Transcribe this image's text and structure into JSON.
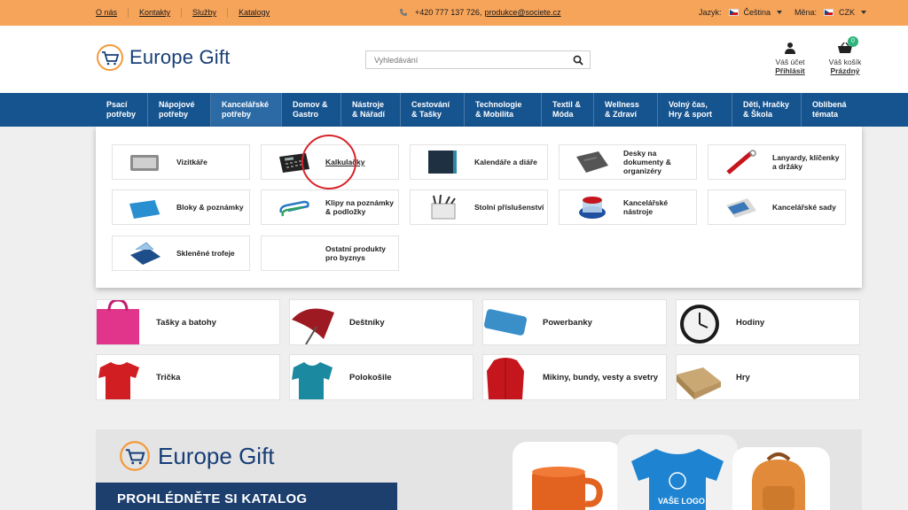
{
  "topbar": {
    "links": [
      "O nás",
      "Kontakty",
      "Služby",
      "Katalogy"
    ],
    "phone": "+420 777 137 726,",
    "email": "produkce@societe.cz",
    "language_label": "Jazyk:",
    "language_value": "Čeština",
    "currency_label": "Měna:",
    "currency_value": "CZK"
  },
  "header": {
    "logo_text": "Europe Gift",
    "search_placeholder": "Vyhledávání",
    "account_line1": "Váš účet",
    "account_line2": "Přihlásit",
    "cart_line1": "Váš košík",
    "cart_line2": "Prázdný",
    "cart_count": "0"
  },
  "nav": {
    "items": [
      {
        "l1": "Psací",
        "l2": "potřeby"
      },
      {
        "l1": "Nápojové",
        "l2": "potřeby"
      },
      {
        "l1": "Kancelářské",
        "l2": "potřeby"
      },
      {
        "l1": "Domov &",
        "l2": "Gastro"
      },
      {
        "l1": "Nástroje",
        "l2": "& Nářadí"
      },
      {
        "l1": "Cestování",
        "l2": "& Tašky"
      },
      {
        "l1": "Technologie",
        "l2": "& Mobilita"
      },
      {
        "l1": "Textil &",
        "l2": "Móda"
      },
      {
        "l1": "Wellness",
        "l2": "& Zdraví"
      },
      {
        "l1": "Volný čas,",
        "l2": "Hry & sport"
      },
      {
        "l1": "Děti, Hračky",
        "l2": "& Škola"
      },
      {
        "l1": "Oblíbená",
        "l2": "témata"
      }
    ]
  },
  "mega": {
    "items": [
      {
        "label": "Vizitkáře",
        "icon": "business-card-holder-icon"
      },
      {
        "label": "Kalkulačky",
        "icon": "calculator-icon"
      },
      {
        "label": "Kalendáře a diáře",
        "icon": "diary-icon"
      },
      {
        "label": "Desky na dokumenty & organizéry",
        "icon": "organizer-icon"
      },
      {
        "label": "Lanyardy, klíčenky a držáky",
        "icon": "lanyard-icon"
      },
      {
        "label": "Bloky & poznámky",
        "icon": "notepad-icon"
      },
      {
        "label": "Klipy na poznámky & podložky",
        "icon": "paper-clip-icon"
      },
      {
        "label": "Stolní příslušenství",
        "icon": "desk-organizer-icon"
      },
      {
        "label": "Kancelářské nástroje",
        "icon": "dispenser-icon"
      },
      {
        "label": "Kancelářské sady",
        "icon": "office-set-icon"
      },
      {
        "label": "Skleněné trofeje",
        "icon": "glass-trophy-icon"
      },
      {
        "label": "Ostatní produkty pro byznys",
        "icon": ""
      }
    ]
  },
  "categories": [
    {
      "label": "Tašky a batohy",
      "icon": "bag-icon"
    },
    {
      "label": "Deštníky",
      "icon": "umbrella-icon"
    },
    {
      "label": "Powerbanky",
      "icon": "powerbank-icon"
    },
    {
      "label": "Hodiny",
      "icon": "clock-icon"
    },
    {
      "label": "Trička",
      "icon": "tshirt-icon"
    },
    {
      "label": "Polokošile",
      "icon": "polo-icon"
    },
    {
      "label": "Mikiny, bundy, vesty a svetry",
      "icon": "jacket-icon"
    },
    {
      "label": "Hry",
      "icon": "board-game-icon"
    }
  ],
  "banner": {
    "logo_text": "Europe Gift",
    "cta": "PROHLÉDNĚTE SI KATALOG",
    "shirt_text": "VAŠE LOGO"
  },
  "colors": {
    "topbar": "#f6a45a",
    "nav": "#16548f",
    "brand_blue": "#173e78",
    "highlight": "#d8232a",
    "badge": "#2db37b"
  }
}
